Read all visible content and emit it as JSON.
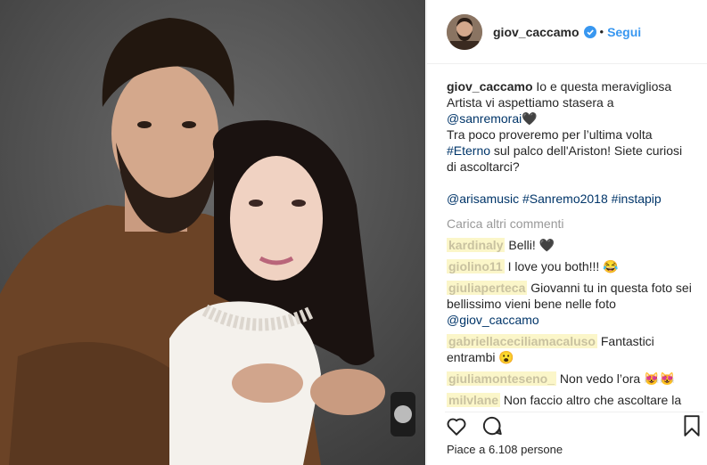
{
  "post": {
    "username": "giov_caccamo",
    "follow_label": "Segui",
    "dot": "•",
    "caption": {
      "user": "giov_caccamo",
      "l1": " Io e questa meravigliosa",
      "l2": "Artista vi aspettiamo stasera a",
      "l3a": "@sanremorai",
      "l3b": "🖤",
      "l4": "Tra poco proveremo per l’ultima volta",
      "l5a": "#Eterno",
      "l5b": " sul palco dell'Ariston! Siete curiosi",
      "l6": "di ascoltarci?",
      "t1": "@arisamusic",
      "t2": "#Sanremo2018",
      "t3": "#instapip"
    },
    "load_more": "Carica altri commenti",
    "comments": [
      {
        "user": "kardinaly",
        "text": " Belli! 🖤"
      },
      {
        "user": "giolino11",
        "text": " I love you both!!! 😂"
      },
      {
        "user": "giuliaperteca",
        "text": " Giovanni tu in questa foto sei bellissimo vieni bene nelle foto ",
        "mention": "@giov_caccamo"
      },
      {
        "user": "gabriellaceciliamacaluso",
        "text": " Fantastici entrambi 😮"
      },
      {
        "user": "giuliamonteseno_",
        "text": " Non vedo l’ora 😻😻"
      },
      {
        "user": "milvlane",
        "text": " Non faccio altro che ascoltare la"
      }
    ],
    "likes": "Piace a 6.108 persone"
  },
  "icons": [
    "verified-icon",
    "heart-icon",
    "comment-icon",
    "bookmark-icon"
  ],
  "colors": {
    "link": "#003569",
    "follow": "#3897f0",
    "verified": "#3897f0",
    "muted": "#999999"
  }
}
